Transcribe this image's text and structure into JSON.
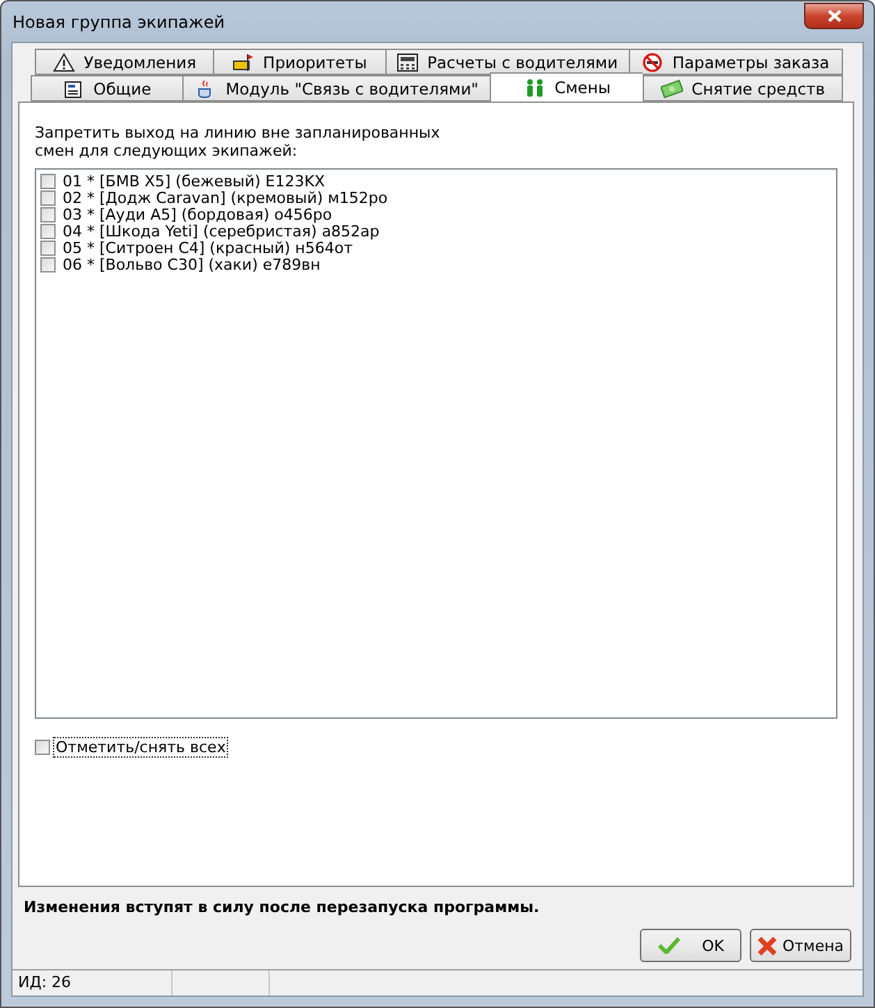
{
  "window": {
    "title": "Новая группа экипажей"
  },
  "tab_rows": [
    {
      "tabs": [
        {
          "label": "Уведомления",
          "selected": false
        },
        {
          "label": "Приоритеты",
          "selected": false
        },
        {
          "label": "Расчеты с водителями",
          "selected": false
        },
        {
          "label": "Параметры заказа",
          "selected": false
        }
      ]
    },
    {
      "tabs": [
        {
          "label": "Общие",
          "selected": false
        },
        {
          "label": "Модуль \"Связь с водителями\"",
          "selected": false
        },
        {
          "label": "Смены",
          "selected": true
        },
        {
          "label": "Снятие средств",
          "selected": false
        }
      ]
    }
  ],
  "description": "Запретить выход на линию вне запланированных смен для следующих экипажей:",
  "crews": [
    {
      "label": "01 * [БМВ X5] (бежевый) E123KX",
      "checked": false
    },
    {
      "label": "02 * [Додж Caravan] (кремовый) м152ро",
      "checked": false
    },
    {
      "label": "03 * [Ауди А5] (бордовая) о456ро",
      "checked": false
    },
    {
      "label": "04 * [Шкода Yeti] (серебристая) а852ар",
      "checked": false
    },
    {
      "label": "05 * [Ситроен С4] (красный) н564от",
      "checked": false
    },
    {
      "label": "06 * [Вольво С30] (хаки) е789вн",
      "checked": false
    }
  ],
  "select_all": {
    "label": "Отметить/снять всех",
    "checked": false
  },
  "notice": "Изменения вступят в силу после перезапуска программы.",
  "buttons": [
    {
      "kind": "ok",
      "label": "OK"
    },
    {
      "kind": "cancel",
      "label": "Отмена"
    }
  ],
  "status_bar": [
    "ИД: 26"
  ]
}
